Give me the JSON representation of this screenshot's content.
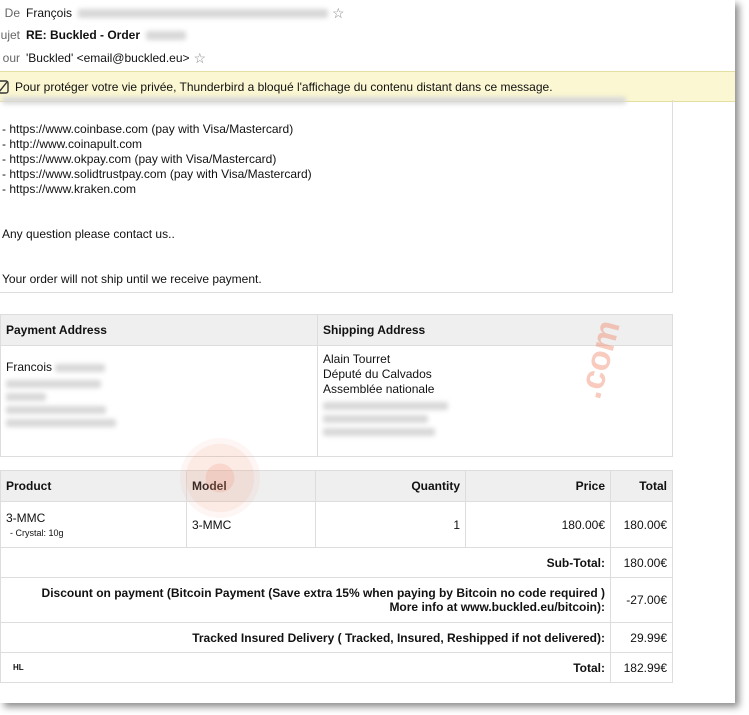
{
  "header": {
    "from_label": "De",
    "from_name": "François",
    "subject_label": "ujet",
    "subject": "RE: Buckled - Order",
    "to_label": "our",
    "to": "'Buckled' <email@buckled.eu>"
  },
  "privacy_bar": {
    "text": "Pour protéger votre vie privée, Thunderbird a bloqué l'affichage du contenu distant dans ce message."
  },
  "body": {
    "links": [
      "- https://www.coinbase.com (pay with Visa/Mastercard)",
      "- http://www.coinapult.com",
      "- https://www.okpay.com (pay with Visa/Mastercard)",
      "- https://www.solidtrustpay.com (pay with Visa/Mastercard)",
      "- https://www.kraken.com"
    ],
    "question": "Any question please contact us..",
    "ship_notice": "Your order will not ship until we receive payment."
  },
  "addresses": {
    "payment_header": "Payment Address",
    "shipping_header": "Shipping Address",
    "payment_name": "Francois",
    "shipping_lines": [
      "Alain Tourret",
      "Député du Calvados",
      "Assemblée nationale"
    ]
  },
  "order": {
    "headers": [
      "Product",
      "Model",
      "Quantity",
      "Price",
      "Total"
    ],
    "product": "3-MMC",
    "option": "- Crystal: 10g",
    "model": "3-MMC",
    "quantity": "1",
    "price": "180.00€",
    "total": "180.00€",
    "subtotal_label": "Sub-Total:",
    "subtotal_value": "180.00€",
    "discount_label": "Discount on payment (Bitcoin Payment (Save extra 15% when paying by Bitcoin no code required ) More info at www.buckled.eu/bitcoin):",
    "discount_value": "-27.00€",
    "shipping_label": "Tracked Insured Delivery ( Tracked, Insured, Reshipped if not delivered):",
    "shipping_value": "29.99€",
    "total_label": "Total:",
    "total_value": "182.99€",
    "footer_mark": "HL"
  },
  "watermark": {
    "text": ".com"
  }
}
